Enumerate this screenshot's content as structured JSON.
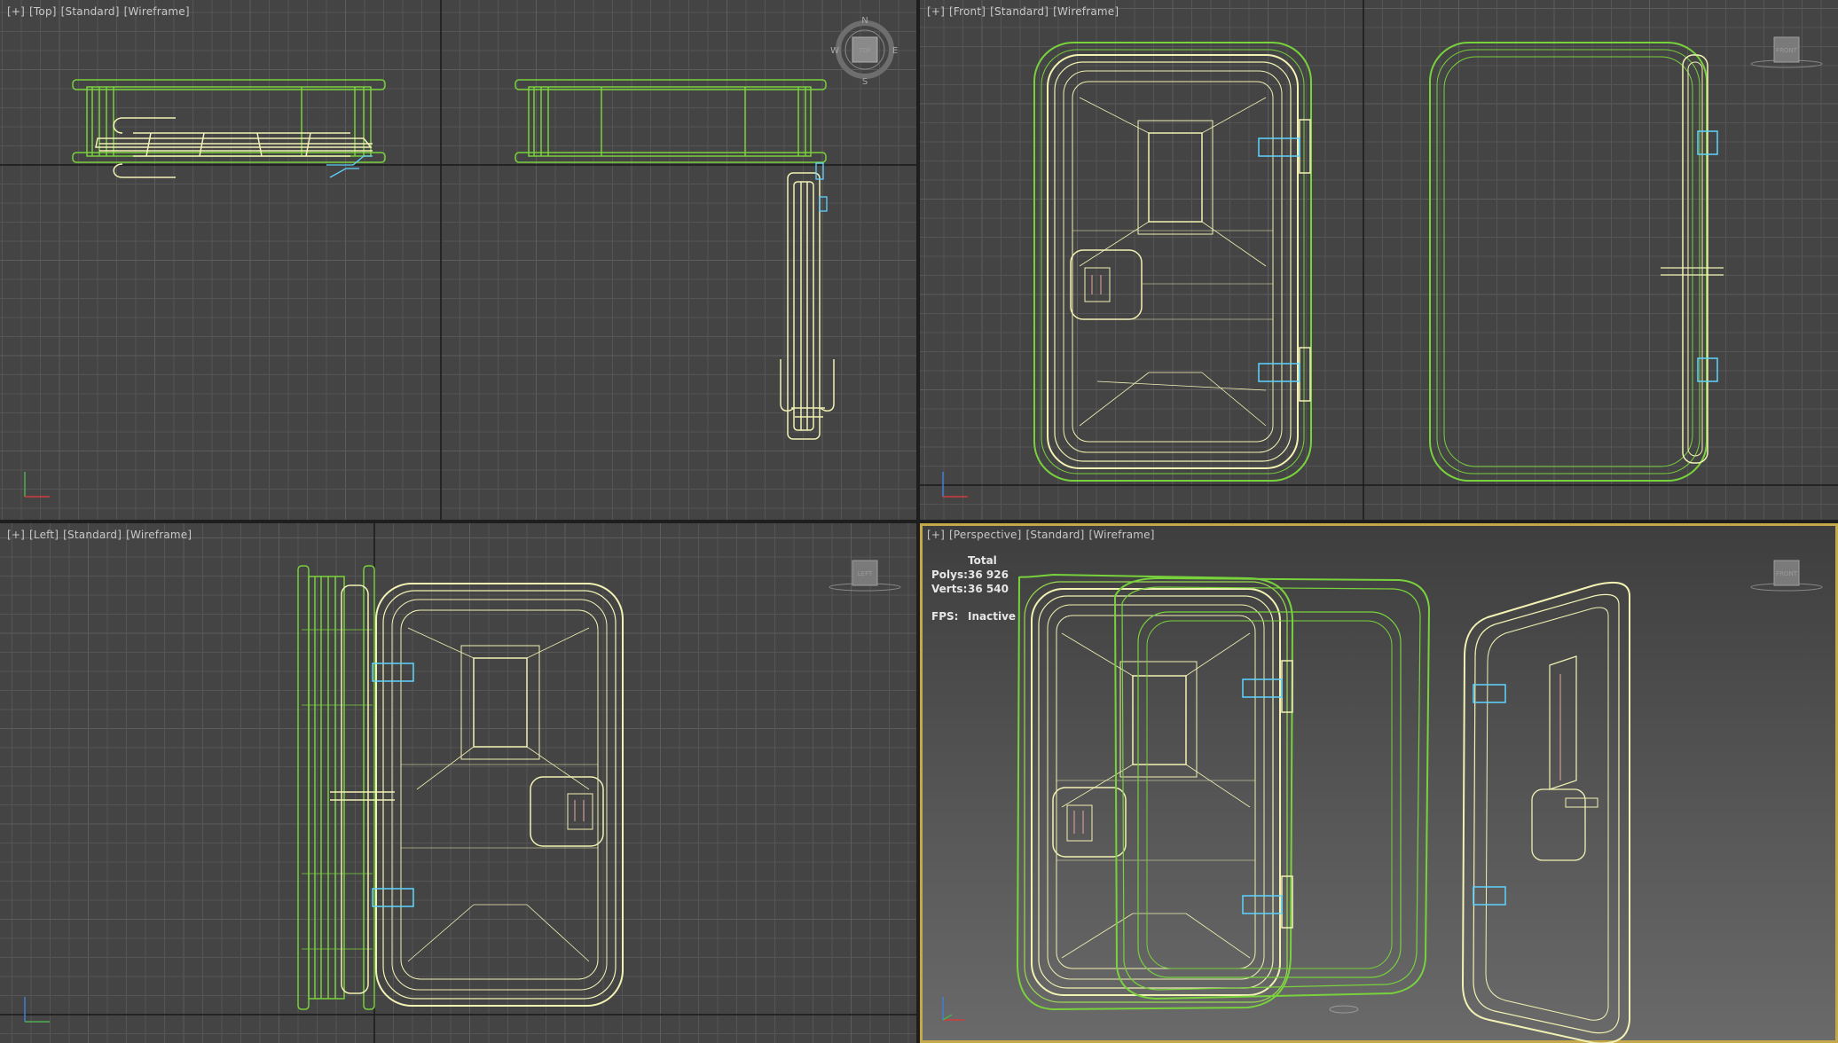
{
  "app": "3ds Max",
  "colors": {
    "bg": "#444444",
    "bg_persp_top": "#3e3e3e",
    "bg_persp_bottom": "#6a6a6a",
    "grid_minor": "#555555",
    "grid_major": "#5d5d5d",
    "grid_axis": "#1a1a1a",
    "wire_green": "#78d23c",
    "wire_yellow": "#f2f2b4",
    "wire_cyan": "#5fd4ff",
    "wire_pink": "#e8a8a0",
    "active_border": "#c4a84a",
    "label_text": "#c8c8c8"
  },
  "viewports": [
    {
      "id": "top",
      "menu": "[+]",
      "view": "[Top]",
      "shading": "[Standard]",
      "mode": "[Wireframe]",
      "active": false,
      "nav": "compass",
      "nav_label": "TOP"
    },
    {
      "id": "front",
      "menu": "[+]",
      "view": "[Front]",
      "shading": "[Standard]",
      "mode": "[Wireframe]",
      "active": false,
      "nav": "viewcube",
      "nav_label": "FRONT"
    },
    {
      "id": "left",
      "menu": "[+]",
      "view": "[Left]",
      "shading": "[Standard]",
      "mode": "[Wireframe]",
      "active": false,
      "nav": "viewcube",
      "nav_label": "LEFT"
    },
    {
      "id": "perspective",
      "menu": "[+]",
      "view": "[Perspective]",
      "shading": "[Standard]",
      "mode": "[Wireframe]",
      "active": true,
      "nav": "viewcube",
      "nav_label": "FRONT"
    }
  ],
  "compass": {
    "n": "N",
    "s": "S",
    "e": "E",
    "w": "W"
  },
  "stats": {
    "header": "Total",
    "polys_label": "Polys:",
    "polys_value": "36 926",
    "verts_label": "Verts:",
    "verts_value": "36 540",
    "fps_label": "FPS:",
    "fps_value": "Inactive"
  }
}
